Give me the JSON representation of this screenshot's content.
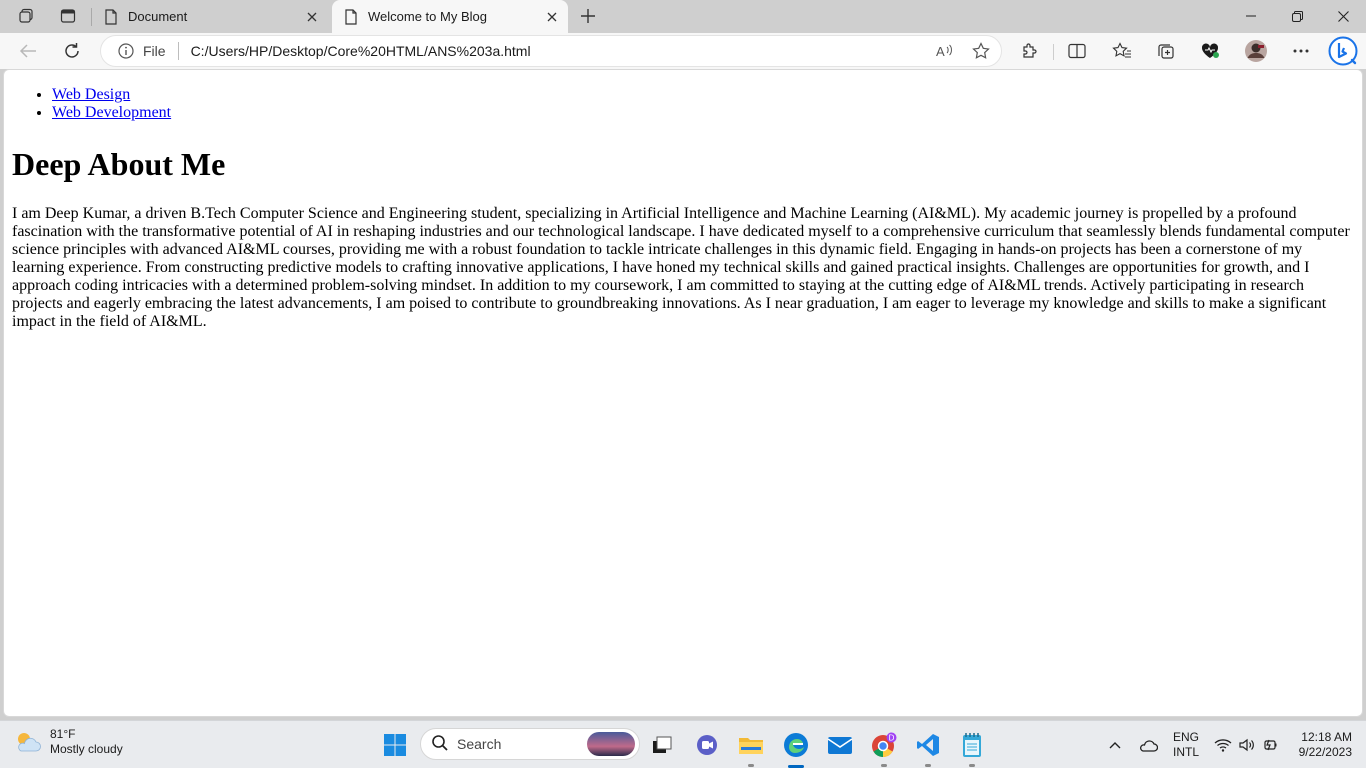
{
  "browser": {
    "tabs": [
      {
        "title": "Document",
        "active": false
      },
      {
        "title": "Welcome to My Blog",
        "active": true
      }
    ],
    "address": {
      "scheme_label": "File",
      "url": "C:/Users/HP/Desktop/Core%20HTML/ANS%203a.html"
    }
  },
  "page": {
    "nav_links": [
      "Web Design",
      "Web Development"
    ],
    "heading": "Deep About Me",
    "paragraph": "I am Deep Kumar, a driven B.Tech Computer Science and Engineering student, specializing in Artificial Intelligence and Machine Learning (AI&ML). My academic journey is propelled by a profound fascination with the transformative potential of AI in reshaping industries and our technological landscape. I have dedicated myself to a comprehensive curriculum that seamlessly blends fundamental computer science principles with advanced AI&ML courses, providing me with a robust foundation to tackle intricate challenges in this dynamic field. Engaging in hands-on projects has been a cornerstone of my learning experience. From constructing predictive models to crafting innovative applications, I have honed my technical skills and gained practical insights. Challenges are opportunities for growth, and I approach coding intricacies with a determined problem-solving mindset. In addition to my coursework, I am committed to staying at the cutting edge of AI&ML trends. Actively participating in research projects and eagerly embracing the latest advancements, I am poised to contribute to groundbreaking innovations. As I near graduation, I am eager to leverage my knowledge and skills to make a significant impact in the field of AI&ML."
  },
  "taskbar": {
    "weather": {
      "temp": "81°F",
      "condition": "Mostly cloudy"
    },
    "search_placeholder": "Search",
    "language": {
      "line1": "ENG",
      "line2": "INTL"
    },
    "clock": {
      "time": "12:18 AM",
      "date": "9/22/2023"
    },
    "chrome_badge": "D"
  },
  "colors": {
    "link": "#0000ee",
    "taskbar_active": "#0067c0",
    "edge_blue": "#0c7bd6"
  }
}
